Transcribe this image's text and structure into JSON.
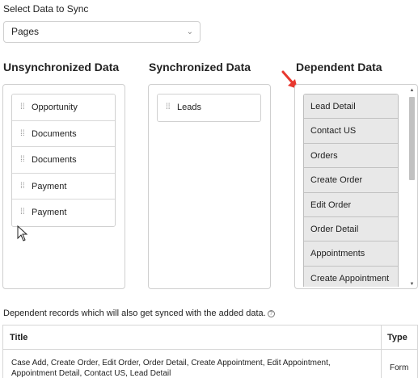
{
  "select_label": "Select Data to Sync",
  "select": {
    "value": "Pages"
  },
  "columns": {
    "unsync_title": "Unsynchronized Data",
    "sync_title": "Synchronized Data",
    "dep_title": "Dependent Data"
  },
  "unsynchronized": [
    "Opportunity",
    "Documents",
    "Documents",
    "Payment",
    "Payment"
  ],
  "synchronized": [
    "Leads"
  ],
  "dependent": [
    "Lead Detail",
    "Contact US",
    "Orders",
    "Create Order",
    "Edit Order",
    "Order Detail",
    "Appointments",
    "Create Appointment"
  ],
  "dep_note": "Dependent records which will also get synced with the added data.",
  "table": {
    "headers": {
      "title": "Title",
      "type": "Type"
    },
    "rows": [
      {
        "title": "Case Add, Create Order, Edit Order, Order Detail, Create Appointment, Edit Appointment, Appointment Detail, Contact US, Lead Detail",
        "type": "Form"
      }
    ]
  },
  "colors": {
    "arrow": "#e8382f",
    "dependent_bg": "#e8e8e8"
  },
  "icons": {
    "drag": "drag-handle-icon",
    "chevron": "chevron-down-icon",
    "info": "info-icon"
  }
}
